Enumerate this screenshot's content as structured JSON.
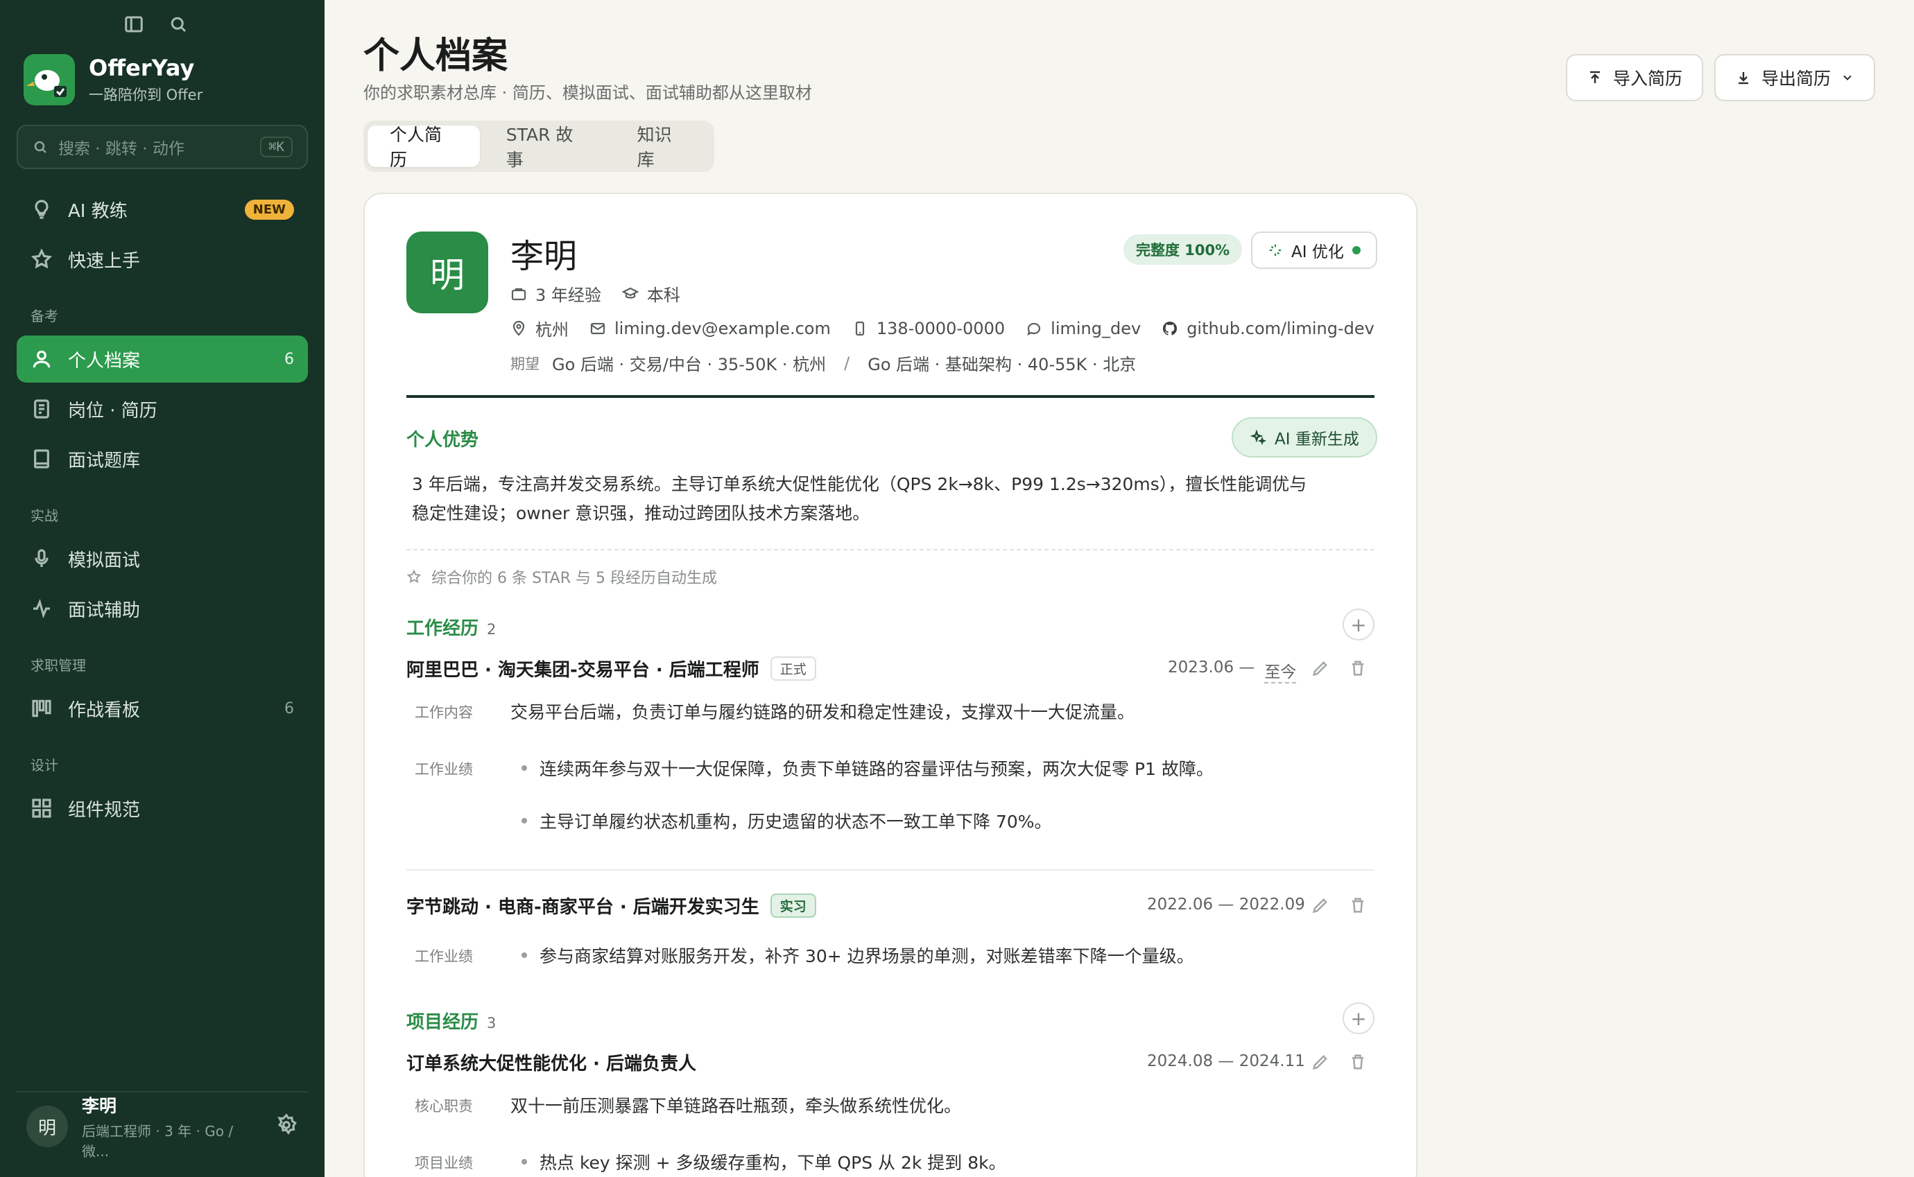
{
  "sidebar": {
    "brand_name": "OfferYay",
    "brand_sub": "一路陪你到 Offer",
    "search_placeholder": "搜索 · 跳转 · 动作",
    "search_shortcut": "⌘K",
    "items": {
      "ai_coach": {
        "label": "AI 教练",
        "badge": "NEW"
      },
      "quick_start": {
        "label": "快速上手"
      },
      "profile": {
        "label": "个人档案",
        "count": "6"
      },
      "jobs_resume": {
        "label": "岗位 · 简历"
      },
      "question_bank": {
        "label": "面试题库"
      },
      "mock_interview": {
        "label": "模拟面试"
      },
      "interview_assist": {
        "label": "面试辅助"
      },
      "battle_board": {
        "label": "作战看板",
        "count": "6"
      },
      "components": {
        "label": "组件规范"
      }
    },
    "sections": {
      "prep": "备考",
      "practice": "实战",
      "job_mgmt": "求职管理",
      "design": "设计"
    },
    "user": {
      "avatar": "明",
      "name": "李明",
      "sub": "后端工程师 · 3 年 · Go / 微..."
    }
  },
  "header": {
    "title": "个人档案",
    "subtitle": "你的求职素材总库 · 简历、模拟面试、面试辅助都从这里取材",
    "import_label": "导入简历",
    "export_label": "导出简历"
  },
  "tabs": [
    "个人简历",
    "STAR 故事",
    "知识库"
  ],
  "profile": {
    "avatar": "明",
    "name": "李明",
    "experience": "3 年经验",
    "education": "本科",
    "city": "杭州",
    "email": "liming.dev@example.com",
    "phone": "138-0000-0000",
    "wechat": "liming_dev",
    "github": "github.com/liming-dev",
    "expect_label": "期望",
    "expect_1": "Go 后端 · 交易/中台 · 35-50K · 杭州",
    "expect_sep": "/",
    "expect_2": "Go 后端 · 基础架构 · 40-55K · 北京",
    "completeness": "完整度 100%",
    "ai_optimize": "AI 优化"
  },
  "advantage": {
    "title": "个人优势",
    "regen_label": "AI 重新生成",
    "line_1": "3 年后端，专注高并发交易系统。主导订单系统大促性能优化（QPS 2k→8k、P99 1.2s→320ms），擅长性能调优与",
    "line_2": "稳定性建设；owner 意识强，推动过跨团队技术方案落地。",
    "hint": "综合你的 6 条 STAR 与 5 段经历自动生成"
  },
  "work": {
    "title": "工作经历",
    "count": "2",
    "jobs": [
      {
        "title": "阿里巴巴 · 淘天集团-交易平台 · 后端工程师",
        "tag": "正式",
        "date_start": "2023.06 —",
        "date_end": "至今",
        "content_label": "工作内容",
        "content": "交易平台后端，负责订单与履约链路的研发和稳定性建设，支撑双十一大促流量。",
        "achieve_label": "工作业绩",
        "bullets": [
          "连续两年参与双十一大促保障，负责下单链路的容量评估与预案，两次大促零 P1 故障。",
          "主导订单履约状态机重构，历史遗留的状态不一致工单下降 70%。"
        ]
      },
      {
        "title": "字节跳动 · 电商-商家平台 · 后端开发实习生",
        "tag": "实习",
        "date_start": "2022.06 — 2022.09",
        "achieve_label": "工作业绩",
        "bullets": [
          "参与商家结算对账服务开发，补齐 30+ 边界场景的单测，对账差错率下降一个量级。"
        ]
      }
    ]
  },
  "projects": {
    "title": "项目经历",
    "count": "3",
    "items": [
      {
        "title": "订单系统大促性能优化 · 后端负责人",
        "date": "2024.08 — 2024.11",
        "duty_label": "核心职责",
        "duty": "双十一前压测暴露下单链路吞吐瓶颈，牵头做系统性优化。",
        "achieve_label": "项目业绩",
        "bullets": [
          "热点 key 探测 + 多级缓存重构，下单 QPS 从 2k 提到 8k。"
        ]
      }
    ]
  },
  "colors": {
    "sidebar_bg": "#173226",
    "accent": "#2d9b4e",
    "page_bg": "#f6f5f0"
  }
}
